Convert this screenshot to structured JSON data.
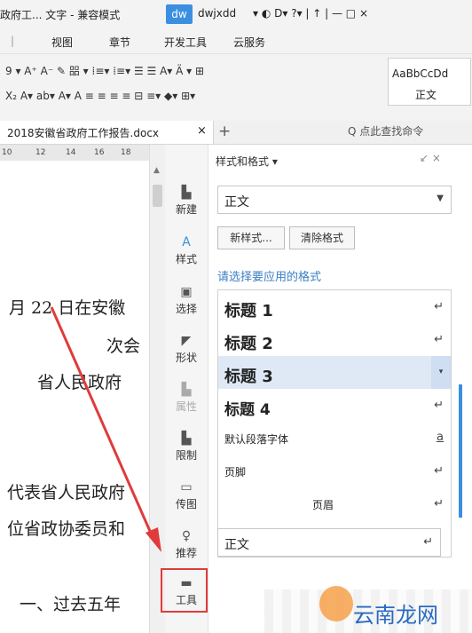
{
  "titlebar": {
    "doc_title": "政府工... 文字 - 兼容模式",
    "dw_badge": "dw",
    "user": "dwjxdd",
    "right_controls": "▾ ◐ D▾ ?▾ | ↑ | — □ ×"
  },
  "menubar": {
    "items": [
      "视图",
      "章节",
      "开发工具",
      "云服务"
    ]
  },
  "ribbon": {
    "row1": "9   ▾ A⁺ A⁻ ✎ 㗊 ▾ ⁞≡▾ ⁞≡▾ ☰ ☰ A▾ Ä ▾ ⊞",
    "row2": "X₂  A▾ ab▾ A▾ A   ≡ ≡ ≡ ≡ ⊟  ≡▾ ◆▾ ⊞▾",
    "style_preview": "AaBbCcDd",
    "style_preview_name": "正文"
  },
  "tabs": {
    "doc_tab": "2018安徽省政府工作报告.docx",
    "close": "×",
    "add": "+",
    "search": "Q 点此查找命令"
  },
  "ruler": {
    "ticks": [
      "10",
      "12",
      "14",
      "16",
      "18"
    ]
  },
  "document": {
    "lines": [
      "月 22 日在安徽",
      "次会",
      "省人民政府",
      "代表省人民政府",
      "位省政协委员和",
      "一、过去五年"
    ]
  },
  "side_tools": [
    {
      "label": "新建",
      "icon": "new-document-icon"
    },
    {
      "label": "样式",
      "icon": "style-icon"
    },
    {
      "label": "选择",
      "icon": "select-icon"
    },
    {
      "label": "形状",
      "icon": "shape-icon"
    },
    {
      "label": "属性",
      "icon": "properties-icon"
    },
    {
      "label": "限制",
      "icon": "restrict-icon"
    },
    {
      "label": "传图",
      "icon": "upload-image-icon"
    },
    {
      "label": "推荐",
      "icon": "recommend-icon"
    },
    {
      "label": "工具",
      "icon": "toolbox-icon"
    }
  ],
  "panel": {
    "title": "样式和格式 ▾",
    "controls": "↙  ×",
    "current_style": "正文",
    "new_style_btn": "新样式...",
    "clear_format_btn": "清除格式",
    "apply_label": "请选择要应用的格式",
    "styles": [
      {
        "name": "标题 1",
        "mark": "↵"
      },
      {
        "name": "标题 2",
        "mark": "↵"
      },
      {
        "name": "标题 3",
        "mark": "▾"
      },
      {
        "name": "标题 4",
        "mark": "↵"
      },
      {
        "name": "默认段落字体",
        "mark": "a"
      },
      {
        "name": "页脚",
        "mark": "↵"
      },
      {
        "name": "页眉",
        "mark": "↵"
      },
      {
        "name": "正文",
        "mark": "↵"
      }
    ]
  },
  "watermark": {
    "text": "云南龙网"
  },
  "colors": {
    "accent": "#3b8fe0",
    "highlight_box": "#e03b3b",
    "link_text": "#3b7fc4"
  }
}
